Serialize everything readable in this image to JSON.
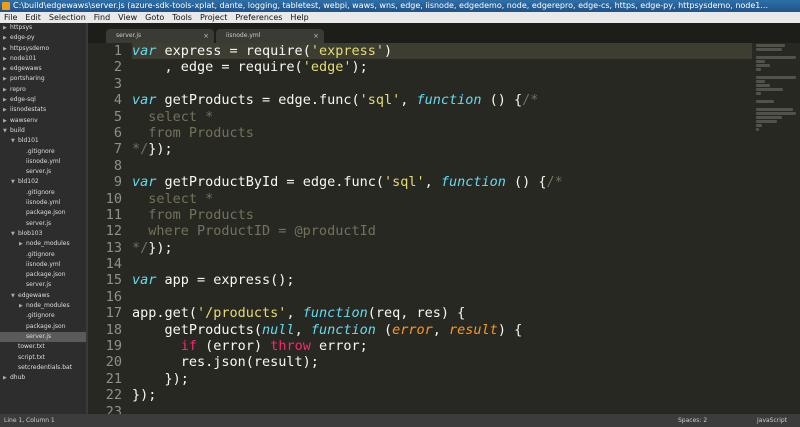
{
  "window": {
    "title": "C:\\build\\edgewaws\\server.js (azure-sdk-tools-xplat, dante, logging, tabletest, webpi, waws, wns, edge, iisnode, edgedemo, node, edgerepro, edge-cs, https, edge-py, httpsysdemo, node1..."
  },
  "menu": [
    "File",
    "Edit",
    "Selection",
    "Find",
    "View",
    "Goto",
    "Tools",
    "Project",
    "Preferences",
    "Help"
  ],
  "sidebar": {
    "items": [
      {
        "label": "httpsys",
        "indent": 0,
        "arrow": "▶"
      },
      {
        "label": "edge-py",
        "indent": 0,
        "arrow": "▶"
      },
      {
        "label": "httpsysdemo",
        "indent": 0,
        "arrow": "▶"
      },
      {
        "label": "node101",
        "indent": 0,
        "arrow": "▶"
      },
      {
        "label": "edgewaws",
        "indent": 0,
        "arrow": "▶"
      },
      {
        "label": "portsharing",
        "indent": 0,
        "arrow": "▶"
      },
      {
        "label": "repro",
        "indent": 0,
        "arrow": "▶"
      },
      {
        "label": "edge-sql",
        "indent": 0,
        "arrow": "▶"
      },
      {
        "label": "iisnodestats",
        "indent": 0,
        "arrow": "▶"
      },
      {
        "label": "wawsenv",
        "indent": 0,
        "arrow": "▶"
      },
      {
        "label": "build",
        "indent": 0,
        "arrow": "▼"
      },
      {
        "label": "bld101",
        "indent": 1,
        "arrow": "▼"
      },
      {
        "label": ".gitignore",
        "indent": 2,
        "arrow": ""
      },
      {
        "label": "iisnode.yml",
        "indent": 2,
        "arrow": ""
      },
      {
        "label": "server.js",
        "indent": 2,
        "arrow": ""
      },
      {
        "label": "bld102",
        "indent": 1,
        "arrow": "▼"
      },
      {
        "label": ".gitignore",
        "indent": 2,
        "arrow": ""
      },
      {
        "label": "iisnode.yml",
        "indent": 2,
        "arrow": ""
      },
      {
        "label": "package.json",
        "indent": 2,
        "arrow": ""
      },
      {
        "label": "server.js",
        "indent": 2,
        "arrow": ""
      },
      {
        "label": "blob103",
        "indent": 1,
        "arrow": "▼"
      },
      {
        "label": "node_modules",
        "indent": 2,
        "arrow": "▶"
      },
      {
        "label": ".gitignore",
        "indent": 2,
        "arrow": ""
      },
      {
        "label": "iisnode.yml",
        "indent": 2,
        "arrow": ""
      },
      {
        "label": "package.json",
        "indent": 2,
        "arrow": ""
      },
      {
        "label": "server.js",
        "indent": 2,
        "arrow": ""
      },
      {
        "label": "edgewaws",
        "indent": 1,
        "arrow": "▼"
      },
      {
        "label": "node_modules",
        "indent": 2,
        "arrow": "▶"
      },
      {
        "label": ".gitignore",
        "indent": 2,
        "arrow": ""
      },
      {
        "label": "package.json",
        "indent": 2,
        "arrow": ""
      },
      {
        "label": "server.js",
        "indent": 2,
        "arrow": "",
        "selected": true
      },
      {
        "label": "tower.txt",
        "indent": 1,
        "arrow": ""
      },
      {
        "label": "script.txt",
        "indent": 1,
        "arrow": ""
      },
      {
        "label": "setcredentials.bat",
        "indent": 1,
        "arrow": ""
      },
      {
        "label": "dhub",
        "indent": 0,
        "arrow": "▶"
      }
    ]
  },
  "tabs": [
    {
      "label": "server.js"
    },
    {
      "label": "iisnode.yml"
    }
  ],
  "editor": {
    "line_numbers": [
      "1",
      "2",
      "3",
      "4",
      "5",
      "6",
      "7",
      "8",
      "9",
      "10",
      "11",
      "12",
      "13",
      "14",
      "15",
      "16",
      "17",
      "18",
      "19",
      "20",
      "21",
      "22",
      "23"
    ],
    "active_line": 1,
    "lines": [
      [
        [
          "k",
          "var"
        ],
        [
          "t",
          " express = require("
        ],
        [
          "s",
          "'express'"
        ],
        [
          "t",
          ")"
        ]
      ],
      [
        [
          "t",
          "    , edge = require("
        ],
        [
          "s",
          "'edge'"
        ],
        [
          "t",
          ");"
        ]
      ],
      [],
      [
        [
          "k",
          "var"
        ],
        [
          "t",
          " getProducts = edge.func("
        ],
        [
          "s",
          "'sql'"
        ],
        [
          "t",
          ", "
        ],
        [
          "k",
          "function"
        ],
        [
          "t",
          " () {"
        ],
        [
          "c",
          "/*"
        ]
      ],
      [
        [
          "c",
          "  select *"
        ]
      ],
      [
        [
          "c",
          "  from Products"
        ]
      ],
      [
        [
          "c",
          "*/"
        ],
        [
          "t",
          "});"
        ]
      ],
      [],
      [
        [
          "k",
          "var"
        ],
        [
          "t",
          " getProductById = edge.func("
        ],
        [
          "s",
          "'sql'"
        ],
        [
          "t",
          ", "
        ],
        [
          "k",
          "function"
        ],
        [
          "t",
          " () {"
        ],
        [
          "c",
          "/*"
        ]
      ],
      [
        [
          "c",
          "  select *"
        ]
      ],
      [
        [
          "c",
          "  from Products"
        ]
      ],
      [
        [
          "c",
          "  where ProductID = @productId"
        ]
      ],
      [
        [
          "c",
          "*/"
        ],
        [
          "t",
          "});"
        ]
      ],
      [],
      [
        [
          "k",
          "var"
        ],
        [
          "t",
          " app = express();"
        ]
      ],
      [],
      [
        [
          "t",
          "app.get("
        ],
        [
          "s",
          "'/products'"
        ],
        [
          "t",
          ", "
        ],
        [
          "k",
          "function"
        ],
        [
          "t",
          "(req, res) {"
        ]
      ],
      [
        [
          "t",
          "    getProducts("
        ],
        [
          "k",
          "null"
        ],
        [
          "t",
          ", "
        ],
        [
          "k",
          "function"
        ],
        [
          "t",
          " ("
        ],
        [
          "p",
          "error"
        ],
        [
          "t",
          ", "
        ],
        [
          "p",
          "result"
        ],
        [
          "t",
          ") {"
        ]
      ],
      [
        [
          "t",
          "      "
        ],
        [
          "r",
          "if"
        ],
        [
          "t",
          " (error) "
        ],
        [
          "r",
          "throw"
        ],
        [
          "t",
          " error;"
        ]
      ],
      [
        [
          "t",
          "      res.json(result);"
        ]
      ],
      [
        [
          "t",
          "    });"
        ]
      ],
      [
        [
          "t",
          "});"
        ]
      ],
      []
    ]
  },
  "status": {
    "position": "Line 1, Column 1",
    "spaces": "Spaces: 2",
    "syntax": "JavaScript"
  }
}
